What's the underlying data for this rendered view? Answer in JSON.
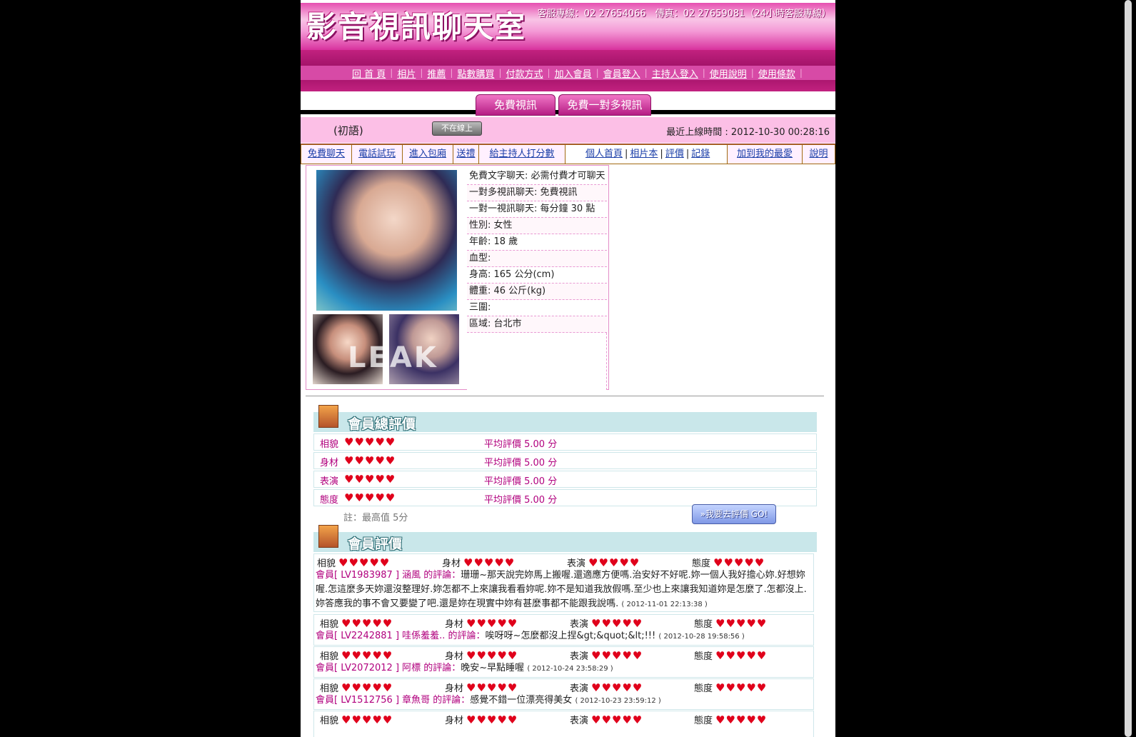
{
  "header": {
    "logo": "影音視訊聊天室",
    "contact": "客服專線：02 27654066　傳真：02 27659081（24小時客服專線）"
  },
  "nav": [
    "回 首 頁",
    "相片",
    "推薦",
    "點數購買",
    "付款方式",
    "加入會員",
    "會員登入",
    "主持人登入",
    "使用說明",
    "使用條款"
  ],
  "tabs": [
    "免費視訊",
    "免費一對多視訊"
  ],
  "status": {
    "nickname": "(初語)",
    "offline_badge": "不在線上",
    "last_online": "最近上線時間 : 2012-10-30 00:28:16"
  },
  "menu": {
    "left": [
      "免費聊天",
      "電話試玩",
      "進入包廂",
      "送禮",
      "給主持人打分數"
    ],
    "mid": [
      "個人首頁",
      "相片本",
      "評價",
      "記錄"
    ],
    "right": [
      "加到我的最愛",
      "說明"
    ]
  },
  "profile": {
    "watermark": "LEAK",
    "info": [
      "免費文字聊天:  必需付費才可聊天",
      "一對多視訊聊天: 免費視訊",
      "一對一視訊聊天: 每分鐘 30 點",
      "性別: 女性",
      "年齡: 18 歲",
      "血型:",
      "身高: 165 公分(cm)",
      "體重: 46 公斤(kg)",
      "三圍:",
      "區域: 台北市"
    ]
  },
  "rating_summary": {
    "title": "會員總評價",
    "rows": [
      {
        "label": "相貌",
        "hearts": "♥♥♥♥♥",
        "avg": "平均評價 5.00 分"
      },
      {
        "label": "身材",
        "hearts": "♥♥♥♥♥",
        "avg": "平均評價 5.00 分"
      },
      {
        "label": "表演",
        "hearts": "♥♥♥♥♥",
        "avg": "平均評價 5.00 分"
      },
      {
        "label": "態度",
        "hearts": "♥♥♥♥♥",
        "avg": "平均評價 5.00 分"
      }
    ],
    "note": "註：最高值 5分",
    "go_button": "»我要去評價 GO!"
  },
  "reviews": {
    "title": "會員評價",
    "categories": [
      "相貌",
      "身材",
      "表演",
      "態度"
    ],
    "hearts": "♥♥♥♥♥",
    "items": [
      {
        "who": "會員[ LV1983987 ] 涵風 的評論：",
        "text": "珊珊~那天說完妳馬上搬喔.還適應方便嗎.治安好不好呢.妳一個人我好擔心妳.好想妳喔.怎這麼多天妳還沒整理好.妳怎都不上來讓我看看妳呢.妳不是知道我放假嗎.至少也上來讓我知道妳是怎麼了.怎都沒上.妳答應我的事不會又要變了吧.還是妳在現實中妳有甚麼事都不能跟我說嗎.",
        "date": "( 2012-11-01 22:13:38 )"
      },
      {
        "who": "會員[ LV2242881 ] 哇係羞羞.. 的評論：",
        "text": "唉呀呀~怎麼都沒上捏&gt;&quot;&lt;!!!",
        "date": "( 2012-10-28 19:58:56 )"
      },
      {
        "who": "會員[ LV2072012 ] 阿標 的評論：",
        "text": "晚安~早點睡喔",
        "date": "( 2012-10-24 23:58:29 )"
      },
      {
        "who": "會員[ LV1512756 ] 章魚哥 的評論：",
        "text": "感覺不錯一位漂亮得美女",
        "date": "( 2012-10-23 23:59:12 )"
      }
    ]
  }
}
